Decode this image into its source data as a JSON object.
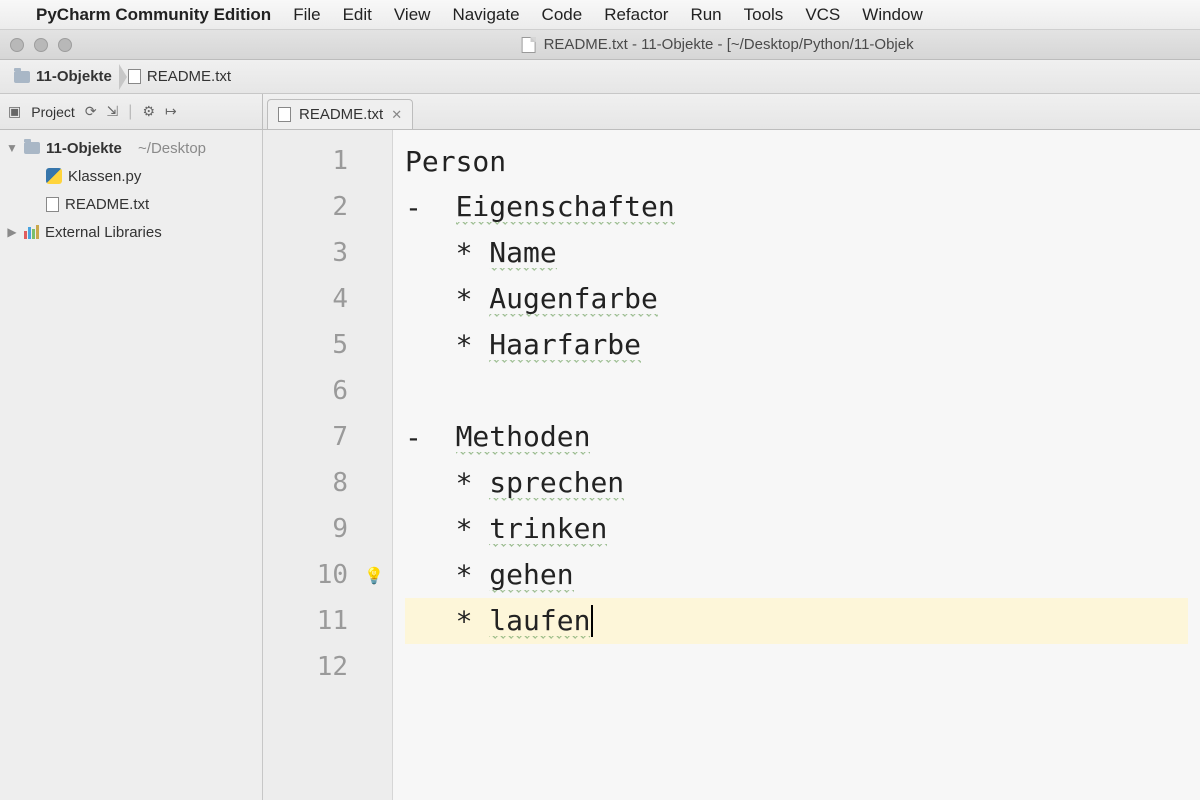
{
  "mac_menu": {
    "app_name": "PyCharm Community Edition",
    "items": [
      "File",
      "Edit",
      "View",
      "Navigate",
      "Code",
      "Refactor",
      "Run",
      "Tools",
      "VCS",
      "Window"
    ]
  },
  "window_title": "README.txt - 11-Objekte - [~/Desktop/Python/11-Objek",
  "breadcrumbs": {
    "project": "11-Objekte",
    "file": "README.txt"
  },
  "toolstrip": {
    "project_label": "Project"
  },
  "editor_tab": {
    "label": "README.txt"
  },
  "sidebar": {
    "root": {
      "name": "11-Objekte",
      "path": "~/Desktop"
    },
    "files": [
      {
        "name": "Klassen.py",
        "kind": "python"
      },
      {
        "name": "README.txt",
        "kind": "text"
      }
    ],
    "external": "External Libraries"
  },
  "editor": {
    "highlight_line": 11,
    "bulb_line": 10,
    "lines": [
      {
        "n": 1,
        "text": "Person"
      },
      {
        "n": 2,
        "text": "-  ",
        "word": "Eigenschaften"
      },
      {
        "n": 3,
        "text": "   * ",
        "word": "Name"
      },
      {
        "n": 4,
        "text": "   * ",
        "word": "Augenfarbe"
      },
      {
        "n": 5,
        "text": "   * ",
        "word": "Haarfarbe"
      },
      {
        "n": 6,
        "text": ""
      },
      {
        "n": 7,
        "text": "-  ",
        "word": "Methoden"
      },
      {
        "n": 8,
        "text": "   * ",
        "word": "sprechen"
      },
      {
        "n": 9,
        "text": "   * ",
        "word": "trinken"
      },
      {
        "n": 10,
        "text": "   * ",
        "word": "gehen"
      },
      {
        "n": 11,
        "text": "   * ",
        "word": "laufen",
        "cursor": true
      },
      {
        "n": 12,
        "text": ""
      }
    ]
  }
}
